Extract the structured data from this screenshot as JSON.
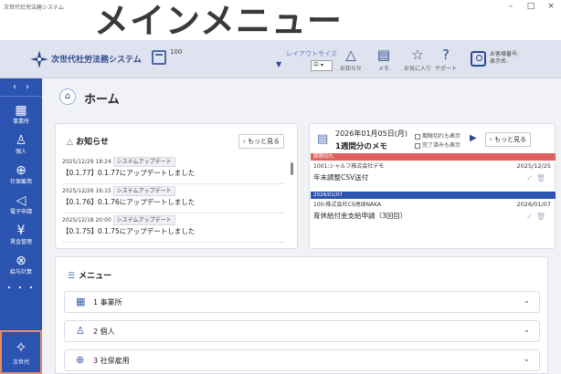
{
  "window": {
    "title": "次世代社労法務システム",
    "controls": [
      "–",
      "□",
      "×"
    ]
  },
  "overlay_title": "メインメニュー",
  "header": {
    "app_name": "次世代社労法務システム",
    "badge_count": "100",
    "layout_label": "レイアウトサイズ",
    "layout_value": "中",
    "buttons": [
      {
        "icon": "notification-icon",
        "label": "お知らせ"
      },
      {
        "icon": "memo-icon",
        "label": "メモ"
      },
      {
        "icon": "star-icon",
        "label": "お気に入り"
      },
      {
        "icon": "help-icon",
        "label": "サポート"
      }
    ],
    "account_line1": "お客様番号:",
    "account_line2": "表示名:"
  },
  "sidebar": {
    "items": [
      {
        "icon": "building-icon",
        "label": "事業所"
      },
      {
        "icon": "person-icon",
        "label": "個人"
      },
      {
        "icon": "insurance-icon",
        "label": "社保雇用"
      },
      {
        "icon": "send-icon",
        "label": "電子申請"
      },
      {
        "icon": "money-icon",
        "label": "賃金管理"
      },
      {
        "icon": "payroll-icon",
        "label": "給与計算"
      }
    ],
    "more": "・・・",
    "brand_label": "次世代"
  },
  "page": {
    "title": "ホーム"
  },
  "notices": {
    "title": "お知らせ",
    "more_label": "もっと見る",
    "items": [
      {
        "datetime": "2025/12/29 18:24",
        "tag": "システムアップデート",
        "text": "【0.1.77】0.1.77にアップデートしました"
      },
      {
        "datetime": "2025/12/26 16:15",
        "tag": "システムアップデート",
        "text": "【0.1.76】0.1.76にアップデートしました"
      },
      {
        "datetime": "2025/12/18 20:00",
        "tag": "システムアップデート",
        "text": "【0.1.75】0.1.75にアップデートしました"
      }
    ]
  },
  "memo": {
    "date": "2026年01月05日(月)",
    "subtitle": "1週間分のメモ",
    "check_expired": "期限切れも表示",
    "check_done": "完了済みも表示",
    "more_label": "もっと見る",
    "band_overdue": "期限切れ",
    "band_date": "2026/01/07",
    "items": [
      {
        "company": "1001:シャルフ株式会社デモ",
        "date": "2025/12/25",
        "title": "年末調整CSV送付"
      },
      {
        "company": "100:株式会社CS地球NAKA",
        "date": "2026/01/07",
        "title": "育休給付金支給申請（3回目）"
      }
    ]
  },
  "menu": {
    "title": "メニュー",
    "rows": [
      {
        "icon": "building-icon",
        "label": "1 事業所"
      },
      {
        "icon": "person-icon",
        "label": "2 個人"
      },
      {
        "icon": "insurance-icon",
        "label": "3 社保雇用"
      }
    ]
  },
  "colors": {
    "sidebar": "#2b53b0",
    "header": "#dfe3ef",
    "overdue_band": "#e0605e",
    "date_band": "#2b53b0",
    "highlight": "#e88a6a"
  }
}
